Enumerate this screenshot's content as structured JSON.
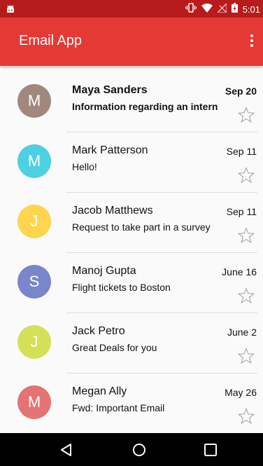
{
  "status_bar": {
    "time": "5:01",
    "icons": [
      "android-icon",
      "vibrate-icon",
      "wifi-icon",
      "no-signal-icon",
      "battery-icon"
    ]
  },
  "app_bar": {
    "title": "Email App",
    "menu_icon": "more-vert-icon"
  },
  "emails": [
    {
      "initial": "M",
      "sender": "Maya Sanders",
      "subject": "Information regarding an intern",
      "date": "Sep 20",
      "unread": true,
      "avatar_color": "#a1887f"
    },
    {
      "initial": "M",
      "sender": "Mark Patterson",
      "subject": "Hello!",
      "date": "Sep 11",
      "unread": false,
      "avatar_color": "#4dd0e1"
    },
    {
      "initial": "J",
      "sender": "Jacob Matthews",
      "subject": "Request to take part in a survey",
      "date": "Sep 11",
      "unread": false,
      "avatar_color": "#ffd54f"
    },
    {
      "initial": "S",
      "sender": "Manoj Gupta",
      "subject": "Flight tickets to Boston",
      "date": "June 16",
      "unread": false,
      "avatar_color": "#7986cb"
    },
    {
      "initial": "J",
      "sender": "Jack Petro",
      "subject": "Great Deals for you",
      "date": "June 2",
      "unread": false,
      "avatar_color": "#d4e157"
    },
    {
      "initial": "M",
      "sender": "Megan Ally",
      "subject": "Fwd: Important Email",
      "date": "May 26",
      "unread": false,
      "avatar_color": "#e57373"
    }
  ],
  "nav_bar": {
    "buttons": [
      "back-icon",
      "home-icon",
      "recents-icon"
    ]
  },
  "colors": {
    "status_bar": "#b71c1c",
    "app_bar": "#e53935",
    "background": "#fafafa"
  }
}
